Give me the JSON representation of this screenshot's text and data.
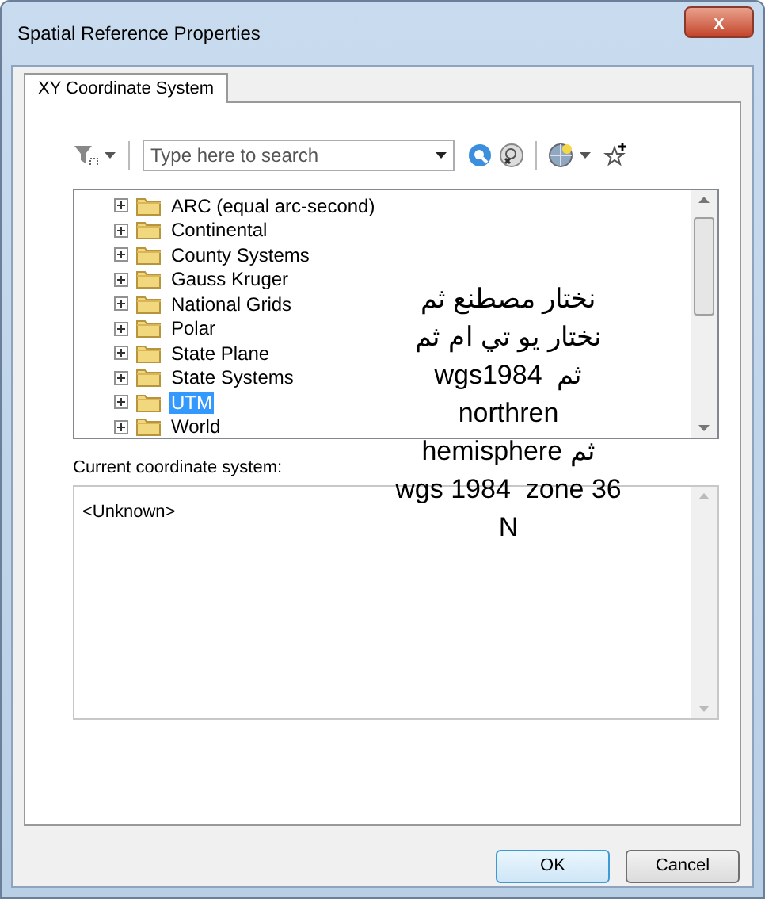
{
  "window": {
    "title": "Spatial Reference Properties",
    "close": "x"
  },
  "tabs": [
    {
      "label": "XY Coordinate System",
      "selected": true
    }
  ],
  "search": {
    "placeholder": "Type here to search"
  },
  "tree": {
    "items": [
      {
        "label": "ARC (equal arc-second)",
        "expanded": false,
        "selected": false
      },
      {
        "label": "Continental",
        "expanded": false,
        "selected": false
      },
      {
        "label": "County Systems",
        "expanded": false,
        "selected": false
      },
      {
        "label": "Gauss Kruger",
        "expanded": false,
        "selected": false
      },
      {
        "label": "National Grids",
        "expanded": false,
        "selected": false
      },
      {
        "label": "Polar",
        "expanded": false,
        "selected": false
      },
      {
        "label": "State Plane",
        "expanded": false,
        "selected": false
      },
      {
        "label": "State Systems",
        "expanded": false,
        "selected": false
      },
      {
        "label": "UTM",
        "expanded": false,
        "selected": true
      },
      {
        "label": "World",
        "expanded": false,
        "selected": false
      }
    ]
  },
  "current": {
    "label": "Current coordinate system:",
    "value": "<Unknown>"
  },
  "annotation": {
    "lines": [
      "نختار مصطنع ثم",
      "نختار يو تي ام ثم",
      "ثم  wgs1984",
      "northren",
      "ثم hemisphere",
      "wgs 1984  zone 36",
      "N"
    ]
  },
  "buttons": [
    {
      "label": "OK",
      "default": true
    },
    {
      "label": "Cancel",
      "default": false
    }
  ]
}
